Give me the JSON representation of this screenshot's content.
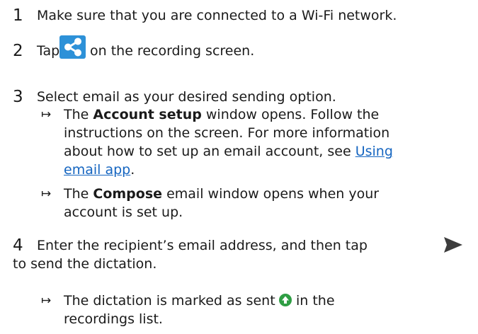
{
  "steps": [
    {
      "number": "1",
      "text": "Make sure that you are connected to a Wi-Fi network."
    },
    {
      "number": "2",
      "text_before": "Tap",
      "text_after": "on the recording screen.",
      "icon": "share-icon"
    },
    {
      "number": "3",
      "text": "Select email as your desired sending option.",
      "results": [
        {
          "arrow": "↦",
          "line1_pre": "The ",
          "line1_bold": "Account setup",
          "line1_post": " window opens. Follow the",
          "line2": "instructions on the screen. For more information",
          "line3_pre": "about how to set up an email account, see ",
          "link_part1": "Using",
          "link_part2": "email app",
          "line4_post": "."
        },
        {
          "arrow": "↦",
          "line1_pre": "The ",
          "line1_bold": "Compose",
          "line1_post": " email window opens when your",
          "line2": "account is set up."
        }
      ]
    },
    {
      "number": "4",
      "line1": "Enter the recipient’s email address, and then tap",
      "line2": "to send the dictation.",
      "icon": "send-icon",
      "results": [
        {
          "arrow": "↦",
          "line1_pre": "The dictation is marked as sent",
          "line2": "recordings list.",
          "icon": "sent-status-icon"
        }
      ]
    }
  ],
  "colors": {
    "share_icon_bg": "#2d91d8",
    "send_icon": "#3c3c3c",
    "sent_status": "#2f9e44",
    "link": "#1565c0"
  }
}
